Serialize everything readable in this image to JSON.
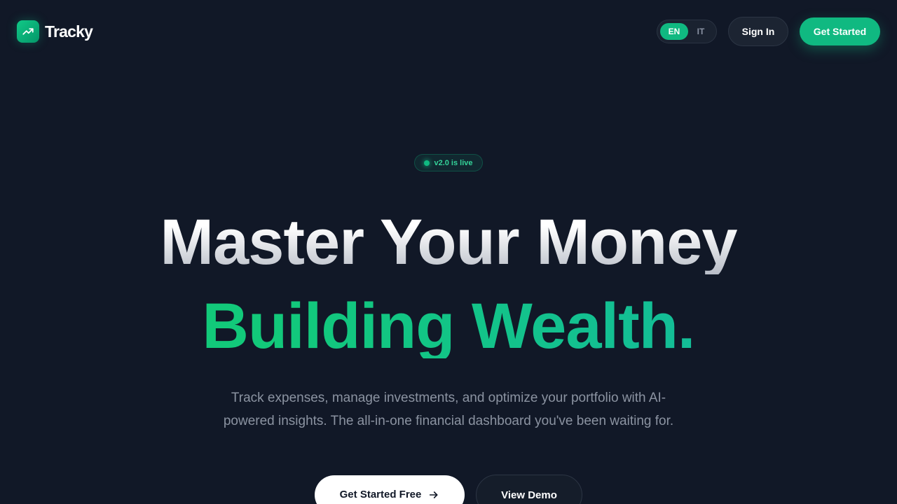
{
  "brand": {
    "name": "Tracky",
    "icon": "trending-up-icon",
    "accent": "#10b981"
  },
  "nav": {
    "languages": [
      {
        "code": "EN",
        "active": true
      },
      {
        "code": "IT",
        "active": false
      }
    ],
    "sign_in_label": "Sign In",
    "get_started_label": "Get Started"
  },
  "hero": {
    "badge_text": "v2.0 is live",
    "headline_line1": "Master Your Money",
    "headline_line2": "Building Wealth.",
    "subtitle": "Track expenses, manage investments, and optimize your portfolio with AI-powered insights. The all-in-one financial dashboard you've been waiting for.",
    "primary_cta": "Get Started Free",
    "primary_cta_icon": "arrow-right-icon",
    "secondary_cta": "View Demo"
  },
  "colors": {
    "background": "#111827",
    "headline_gradient": [
      "#ffffff",
      "#b8bdc7"
    ],
    "accent_gradient": [
      "#12c97a",
      "#14b8a6"
    ]
  }
}
